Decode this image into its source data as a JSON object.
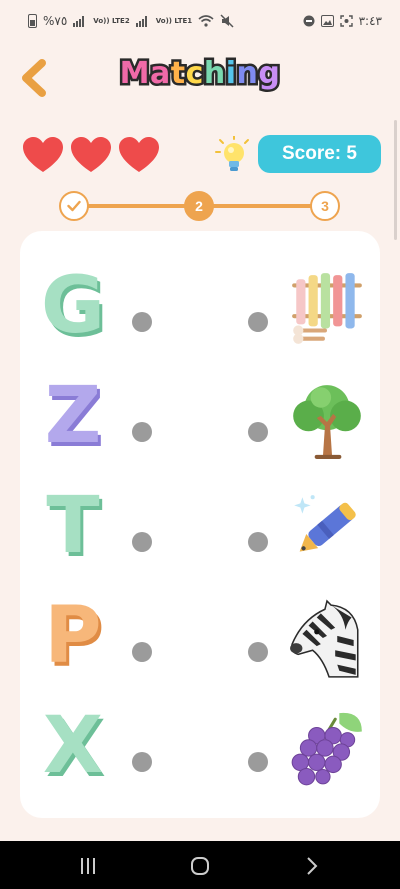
{
  "status_bar": {
    "battery_text": "%٧٥",
    "network1": "Vo)) LTE2",
    "network2": "Vo)) LTE1",
    "time": "٣:٤٣"
  },
  "header": {
    "title": "Matching",
    "title_colors": [
      "#f06aa8",
      "#f06aa8",
      "#ffb24a",
      "#ffd84a",
      "#7ad9b0",
      "#55c6ec",
      "#7f8bf0",
      "#c88ef5"
    ]
  },
  "lives": {
    "count": 3,
    "color": "#ee4b4b"
  },
  "score": {
    "label": "Score: 5",
    "value": 5,
    "background": "#3ec6dc"
  },
  "progress": {
    "steps": [
      {
        "label": "",
        "state": "done"
      },
      {
        "label": "2",
        "state": "current"
      },
      {
        "label": "3",
        "state": "upcoming"
      }
    ],
    "accent": "#eea44f"
  },
  "rows": [
    {
      "letter": "G",
      "letter_color": "#a6e0c3",
      "shadow": "#6dbf98",
      "picture": "xylophone-icon"
    },
    {
      "letter": "Z",
      "letter_color": "#b3a8ec",
      "shadow": "#8a7cd6",
      "picture": "tree-icon"
    },
    {
      "letter": "T",
      "letter_color": "#a6e0c3",
      "shadow": "#6dbf98",
      "picture": "pen-icon"
    },
    {
      "letter": "P",
      "letter_color": "#f7b77a",
      "shadow": "#e08c45",
      "picture": "zebra-icon"
    },
    {
      "letter": "X",
      "letter_color": "#a6e0c3",
      "shadow": "#6dbf98",
      "picture": "grapes-icon"
    }
  ],
  "nav": {
    "buttons": [
      "recent-apps-icon",
      "home-icon",
      "back-nav-icon"
    ]
  }
}
